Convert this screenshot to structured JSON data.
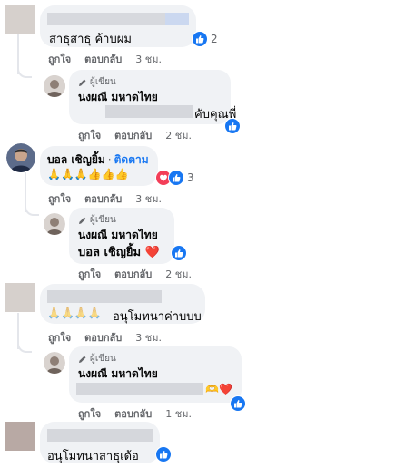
{
  "labels": {
    "author": "ผู้เขียน",
    "like": "ถูกใจ",
    "reply": "ตอบกลับ",
    "follow": "ติดตาม"
  },
  "comments": [
    {
      "text": "สาธุสาธุ ค้าบผม",
      "reactions": "2",
      "time": "3 ชม."
    },
    {
      "name": "นงผณี มหาดไทย",
      "text": "คับคุณพี่",
      "time": "2 ชม."
    },
    {
      "name": "บอล เชิญยิ้ม",
      "text": "🙏🙏🙏👍👍👍",
      "reactions": "3",
      "time": "3 ชม."
    },
    {
      "name": "นงผณี มหาดไทย",
      "text": "บอล เชิญยิ้ม ❤️",
      "time": "2 ชม."
    },
    {
      "text_prefix": "🙏🙏🙏🙏",
      "text": "อนุโมทนาค่าบบบ",
      "time": "3 ชม."
    },
    {
      "name": "นงผณี มหาดไทย",
      "text": "🫶❤️",
      "time": "1 ชม."
    },
    {
      "text": "อนุโมทนาสาธุเด้อ"
    }
  ],
  "colors": {
    "like_blue": "#1877f2",
    "love_red": "#f33e58",
    "bubble_bg": "#f0f2f5",
    "meta_gray": "#65676b"
  }
}
